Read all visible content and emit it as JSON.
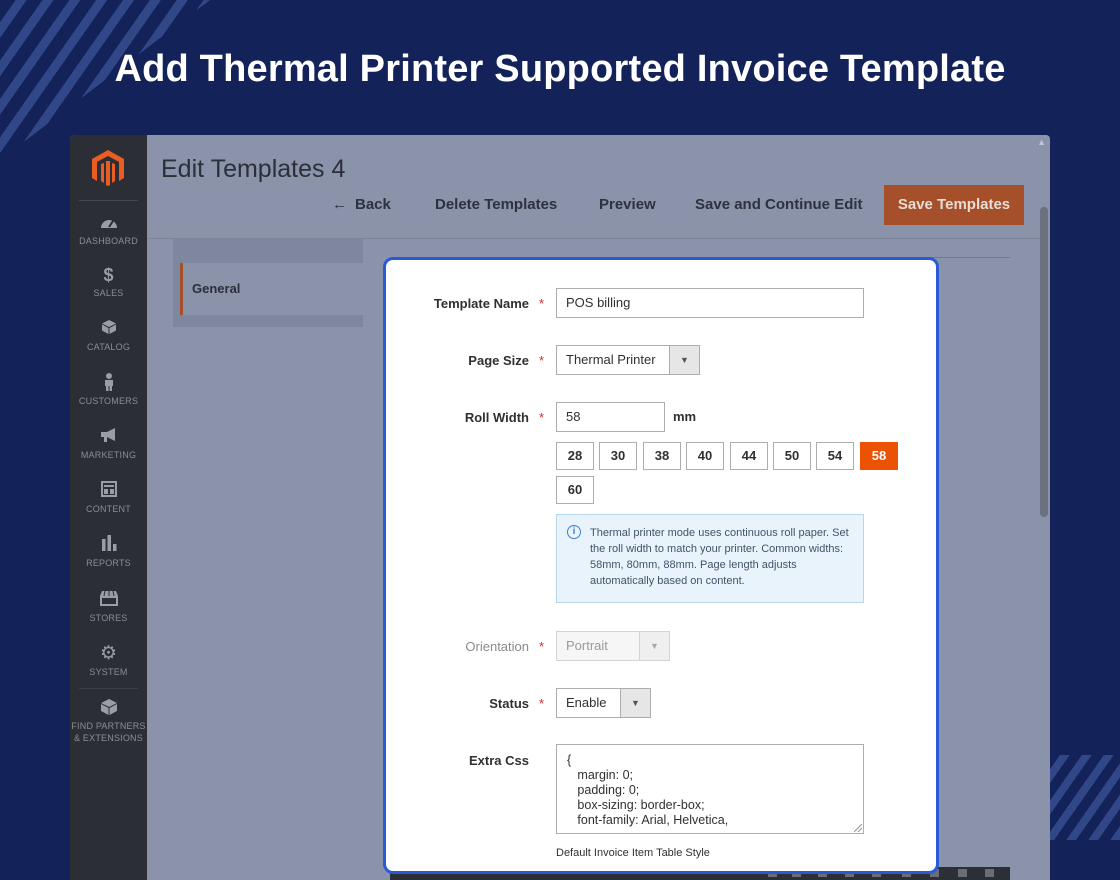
{
  "headline": "Add Thermal Printer Supported Invoice Template",
  "colors": {
    "background": "#13235a",
    "accent": "#eb5202",
    "save_button": "#a5502b",
    "modal_border": "#2a59d8",
    "sidebar": "#2c2e36"
  },
  "sidebar": {
    "logo": "magento-logo-icon",
    "items": [
      {
        "label": "DASHBOARD",
        "icon": "dashboard-icon"
      },
      {
        "label": "SALES",
        "icon": "dollar-icon"
      },
      {
        "label": "CATALOG",
        "icon": "box-icon"
      },
      {
        "label": "CUSTOMERS",
        "icon": "person-icon"
      },
      {
        "label": "MARKETING",
        "icon": "megaphone-icon"
      },
      {
        "label": "CONTENT",
        "icon": "layout-icon"
      },
      {
        "label": "REPORTS",
        "icon": "bar-chart-icon"
      },
      {
        "label": "STORES",
        "icon": "store-icon"
      },
      {
        "label": "SYSTEM",
        "icon": "gear-icon"
      },
      {
        "label_line1": "FIND PARTNERS",
        "label_line2": "& EXTENSIONS",
        "icon": "cube-icon"
      }
    ]
  },
  "page": {
    "title": "Edit Templates 4",
    "toolbar": {
      "back": "Back",
      "delete": "Delete Templates",
      "preview": "Preview",
      "save_continue": "Save and Continue Edit",
      "save": "Save Templates"
    },
    "tabs": [
      {
        "label": "General",
        "active": true
      }
    ]
  },
  "form": {
    "template_name": {
      "label": "Template Name",
      "value": "POS billing",
      "required": true
    },
    "page_size": {
      "label": "Page Size",
      "value": "Thermal Printer",
      "required": true
    },
    "roll_width": {
      "label": "Roll Width",
      "value": "58",
      "unit": "mm",
      "required": true,
      "presets": [
        "28",
        "30",
        "38",
        "40",
        "44",
        "50",
        "54",
        "58",
        "60"
      ],
      "selected": "58"
    },
    "info": "Thermal printer mode uses continuous roll paper. Set the roll width to match your printer. Common widths: 58mm, 80mm, 88mm. Page length adjusts automatically based on content.",
    "orientation": {
      "label": "Orientation",
      "value": "Portrait",
      "required": true,
      "disabled": true
    },
    "status": {
      "label": "Status",
      "value": "Enable",
      "required": true
    },
    "extra_css": {
      "label": "Extra Css",
      "value": "{\n   margin: 0;\n   padding: 0;\n   box-sizing: border-box;\n   font-family: Arial, Helvetica,"
    },
    "hint": "Default Invoice Item Table Style"
  }
}
